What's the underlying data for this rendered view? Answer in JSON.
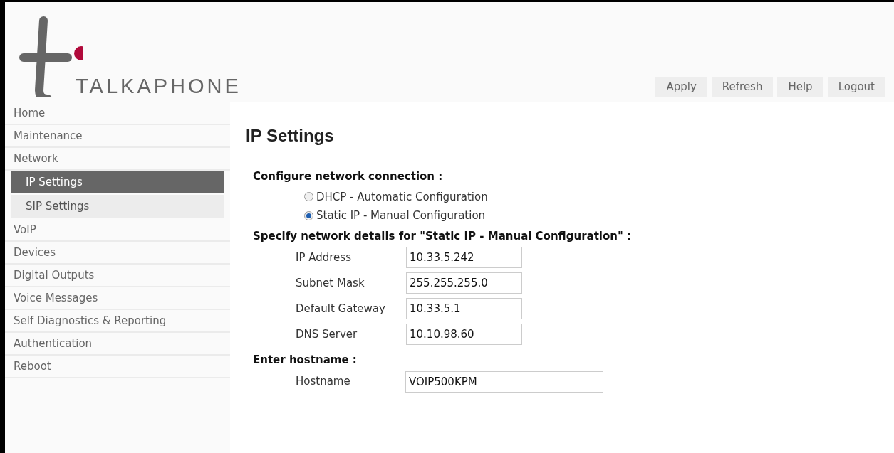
{
  "logo": {
    "text": "TALKAPHONE"
  },
  "toolbar": [
    {
      "label": "Apply"
    },
    {
      "label": "Refresh"
    },
    {
      "label": "Help"
    },
    {
      "label": "Logout"
    }
  ],
  "sidebar": {
    "items": [
      {
        "label": "Home",
        "selected": false
      },
      {
        "label": "Maintenance",
        "selected": false
      },
      {
        "label": "Network",
        "selected": false,
        "children": [
          {
            "label": "IP Settings",
            "selected": true
          },
          {
            "label": "SIP Settings",
            "selected": false
          }
        ]
      },
      {
        "label": "VoIP",
        "selected": false
      },
      {
        "label": "Devices",
        "selected": false
      },
      {
        "label": "Digital Outputs",
        "selected": false
      },
      {
        "label": "Voice Messages",
        "selected": false
      },
      {
        "label": "Self Diagnostics & Reporting",
        "selected": false
      },
      {
        "label": "Authentication",
        "selected": false
      },
      {
        "label": "Reboot",
        "selected": false
      }
    ]
  },
  "page_title": "IP Settings",
  "connection": {
    "heading": "Configure network connection :",
    "options": [
      {
        "label": "DHCP - Automatic Configuration",
        "selected": false
      },
      {
        "label": "Static IP - Manual Configuration",
        "selected": true
      }
    ]
  },
  "details": {
    "heading": "Specify network details for \"Static IP - Manual Configuration\" :",
    "fields": [
      {
        "label": "IP Address",
        "value": "10.33.5.242"
      },
      {
        "label": "Subnet Mask",
        "value": "255.255.255.0"
      },
      {
        "label": "Default Gateway",
        "value": "10.33.5.1"
      },
      {
        "label": "DNS Server",
        "value": "10.10.98.60"
      }
    ]
  },
  "hostname": {
    "heading": "Enter hostname :",
    "label": "Hostname",
    "value": "VOIP500KPM"
  }
}
